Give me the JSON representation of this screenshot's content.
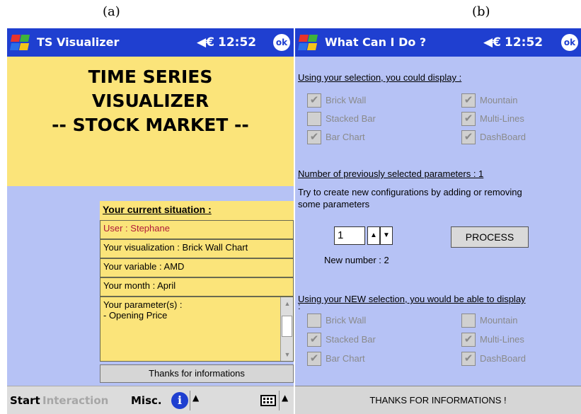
{
  "captions": {
    "a": "(a)",
    "b": "(b)"
  },
  "screen_a": {
    "title": "TS Visualizer",
    "speaker": "◀€",
    "time": "12:52",
    "ok": "ok",
    "banner": [
      "TIME SERIES",
      "VISUALIZER",
      "-- STOCK MARKET --"
    ],
    "situation": {
      "heading": "Your current situation :",
      "user": "User : Stephane",
      "visualization": "Your visualization : Brick Wall Chart",
      "variable": "Your variable : AMD",
      "month": "Your month : April",
      "parameters_title": "Your parameter(s) :",
      "parameters_item": "- Opening Price"
    },
    "thanks_button": "Thanks for informations",
    "taskbar": {
      "start": "Start",
      "interaction": "Interaction",
      "misc": "Misc.",
      "info": "i"
    }
  },
  "screen_b": {
    "title": "What Can I Do ?",
    "speaker": "◀€",
    "time": "12:52",
    "ok": "ok",
    "section1_heading": "Using your selection, you could display :",
    "options_current": [
      {
        "label": "Brick Wall",
        "checked": true
      },
      {
        "label": "Mountain",
        "checked": true
      },
      {
        "label": "Stacked Bar",
        "checked": false
      },
      {
        "label": "Multi-Lines",
        "checked": true
      },
      {
        "label": "Bar Chart",
        "checked": true
      },
      {
        "label": "DashBoard",
        "checked": true
      }
    ],
    "params_count": "Number of previously selected parameters : 1",
    "instructions_line1": "Try to create new configurations by adding or removing",
    "instructions_line2": "some parameters",
    "number_value": "1",
    "process_button": "PROCESS",
    "new_number": "New number : 2",
    "section2_heading": "Using your NEW selection, you would be able to display",
    "section2_colon": ":",
    "options_new": [
      {
        "label": "Brick Wall",
        "checked": false
      },
      {
        "label": "Mountain",
        "checked": false
      },
      {
        "label": "Stacked Bar",
        "checked": true
      },
      {
        "label": "Multi-Lines",
        "checked": true
      },
      {
        "label": "Bar Chart",
        "checked": true
      },
      {
        "label": "DashBoard",
        "checked": true
      }
    ],
    "thanks_button": "THANKS FOR INFORMATIONS !"
  }
}
